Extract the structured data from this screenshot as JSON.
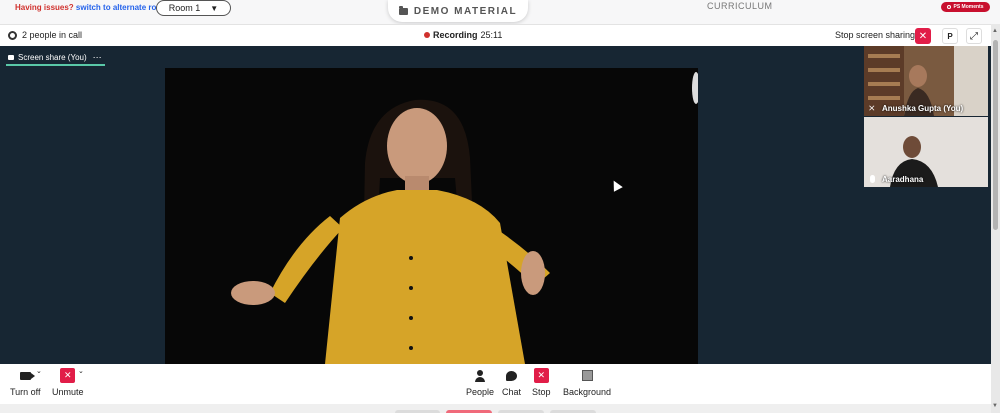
{
  "topbar": {
    "issues_text": "Having issues?",
    "alternate_link": "switch to alternate room",
    "room_label": "Room 1",
    "demo_material_label": "DEMO MATERIAL",
    "curriculum_label": "CURRICULUM",
    "ps_moments_label": "PS Moments"
  },
  "callbar": {
    "people_count": "2 people in call",
    "recording_label": "Recording",
    "recording_time": "25:11",
    "stop_sharing_label": "Stop screen sharing",
    "p_label": "P"
  },
  "stage": {
    "share_tab_label": "Screen share (You)"
  },
  "participants": [
    {
      "name": "Anushka Gupta (You)",
      "muted": true
    },
    {
      "name": "Aaradhana",
      "muted": false
    }
  ],
  "controls": {
    "turn_off_label": "Turn off",
    "unmute_label": "Unmute",
    "people_label": "People",
    "chat_label": "Chat",
    "stop_label": "Stop",
    "background_label": "Background"
  },
  "colors": {
    "accent_red": "#e11d48",
    "stage_bg": "#172633",
    "share_tab_underline": "#5ac8a8"
  }
}
